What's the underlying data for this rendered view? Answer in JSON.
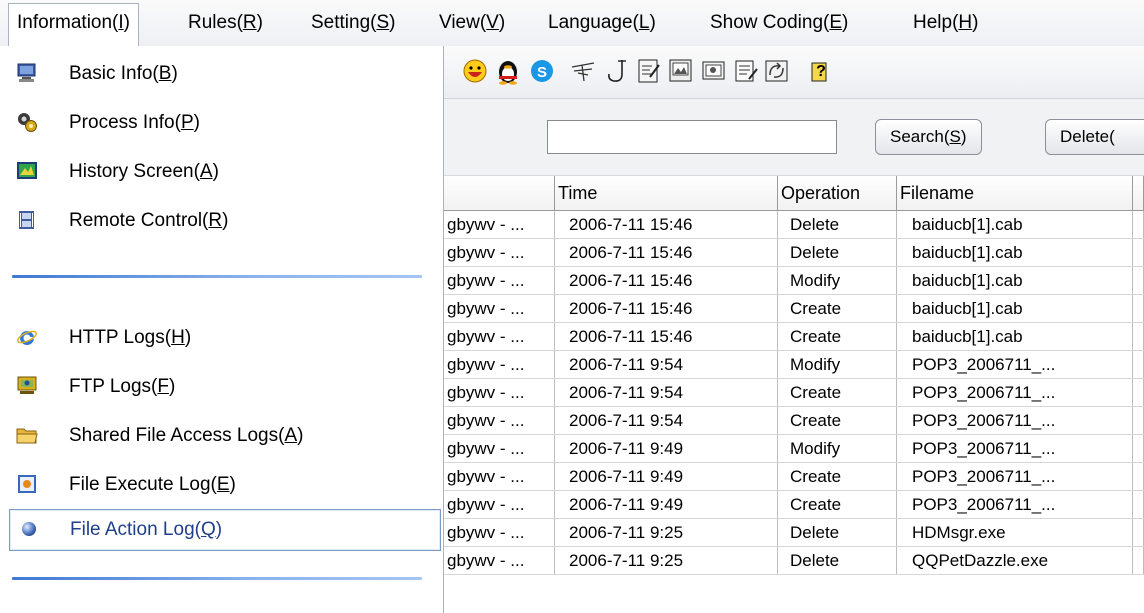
{
  "menubar": {
    "items": [
      {
        "label": "Information(",
        "key": "I",
        "end": ")"
      },
      {
        "label": "Rules(",
        "key": "R",
        "end": ")"
      },
      {
        "label": "Setting(",
        "key": "S",
        "end": ")"
      },
      {
        "label": "View(",
        "key": "V",
        "end": ")"
      },
      {
        "label": "Language(",
        "key": "L",
        "end": ")"
      },
      {
        "label": "Show Coding(",
        "key": "E",
        "end": ")"
      },
      {
        "label": "Help(",
        "key": "H",
        "end": ")"
      }
    ]
  },
  "dropmenu": {
    "items": [
      {
        "label": "Basic Info(",
        "key": "B",
        "end": ")",
        "icon": "computer-icon"
      },
      {
        "label": "Process Info(",
        "key": "P",
        "end": ")",
        "icon": "gears-icon"
      },
      {
        "label": "History Screen(",
        "key": "A",
        "end": ")",
        "icon": "screen-history-icon"
      },
      {
        "label": "Remote Control(",
        "key": "R",
        "end": ")",
        "icon": "film-icon"
      },
      {
        "label": "HTTP Logs(",
        "key": "H",
        "end": ")",
        "icon": "ie-icon"
      },
      {
        "label": "FTP Logs(",
        "key": "F",
        "end": ")",
        "icon": "ftp-icon"
      },
      {
        "label": "Shared File Access Logs(",
        "key": "A",
        "end": ")",
        "icon": "folder-icon"
      },
      {
        "label": "File Execute Log(",
        "key": "E",
        "end": ")",
        "icon": "execute-icon"
      },
      {
        "label": "File Action Log(",
        "key": "Q",
        "end": ")",
        "icon": "sphere-icon"
      }
    ]
  },
  "toolbar": {
    "icons": [
      "smiley-icon",
      "qq-penguin-icon",
      "skype-icon",
      "antenna-icon",
      "hook-icon",
      "document-edit-icon",
      "picture-icon",
      "screen-capture-icon",
      "notepad-icon",
      "image-refresh-icon",
      "help-icon"
    ]
  },
  "search": {
    "value": "",
    "button": {
      "label": "Search(",
      "key": "S",
      "end": ")"
    },
    "delete": {
      "label": "Delete("
    }
  },
  "table": {
    "headers": [
      "",
      "Time",
      "Operation",
      "Filename",
      ""
    ],
    "rows": [
      [
        "gbywv - ...",
        "2006-7-11 15:46",
        "Delete",
        "baiducb[1].cab"
      ],
      [
        "gbywv - ...",
        "2006-7-11 15:46",
        "Delete",
        "baiducb[1].cab"
      ],
      [
        "gbywv - ...",
        "2006-7-11 15:46",
        "Modify",
        "baiducb[1].cab"
      ],
      [
        "gbywv - ...",
        "2006-7-11 15:46",
        "Create",
        "baiducb[1].cab"
      ],
      [
        "gbywv - ...",
        "2006-7-11 15:46",
        "Create",
        "baiducb[1].cab"
      ],
      [
        "gbywv - ...",
        "2006-7-11 9:54",
        "Modify",
        "POP3_2006711_..."
      ],
      [
        "gbywv - ...",
        "2006-7-11 9:54",
        "Create",
        "POP3_2006711_..."
      ],
      [
        "gbywv - ...",
        "2006-7-11 9:54",
        "Create",
        "POP3_2006711_..."
      ],
      [
        "gbywv - ...",
        "2006-7-11 9:49",
        "Modify",
        "POP3_2006711_..."
      ],
      [
        "gbywv - ...",
        "2006-7-11 9:49",
        "Create",
        "POP3_2006711_..."
      ],
      [
        "gbywv - ...",
        "2006-7-11 9:49",
        "Create",
        "POP3_2006711_..."
      ],
      [
        "gbywv - ...",
        "2006-7-11 9:25",
        "Delete",
        "HDMsgr.exe"
      ],
      [
        "gbywv - ...",
        "2006-7-11 9:25",
        "Delete",
        "QQPetDazzle.exe"
      ]
    ]
  }
}
